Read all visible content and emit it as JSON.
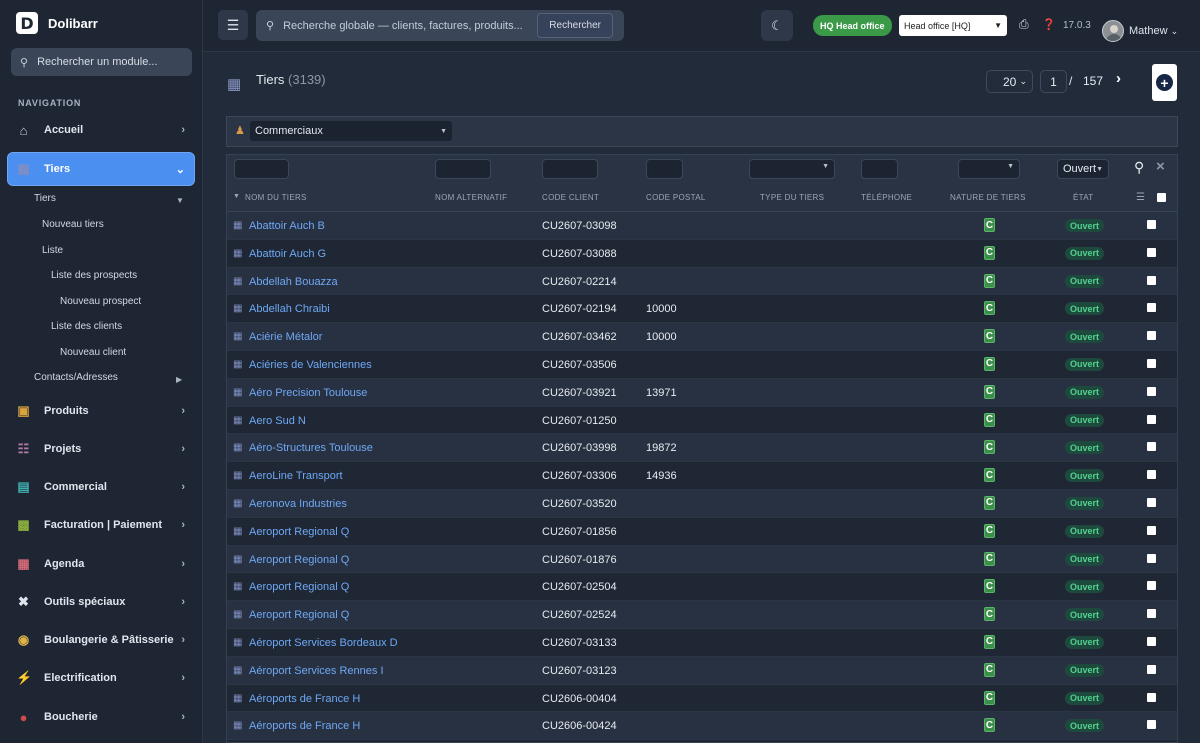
{
  "brand": {
    "logo": "D",
    "name": "Dolibarr"
  },
  "sidebar": {
    "module_search_placeholder": "Rechercher un module...",
    "heading": "NAVIGATION",
    "main_items": [
      {
        "label": "Accueil",
        "icon": "home-icon"
      },
      {
        "label": "Tiers",
        "icon": "building-icon",
        "active": true
      },
      {
        "label": "Produits",
        "icon": "box-icon"
      },
      {
        "label": "Projets",
        "icon": "sitemap-icon"
      },
      {
        "label": "Commercial",
        "icon": "briefcase-icon"
      },
      {
        "label": "Facturation | Paiement",
        "icon": "invoice-icon"
      },
      {
        "label": "Agenda",
        "icon": "calendar-icon"
      },
      {
        "label": "Outils spéciaux",
        "icon": "tools-icon"
      },
      {
        "label": "Boulangerie & Pâtisserie",
        "icon": "bread-icon"
      },
      {
        "label": "Electrification",
        "icon": "lightning-icon"
      },
      {
        "label": "Boucherie",
        "icon": "meat-icon"
      }
    ],
    "sub_items": [
      {
        "label": "Tiers"
      },
      {
        "label": "Nouveau tiers"
      },
      {
        "label": "Liste"
      },
      {
        "label": "Liste des prospects"
      },
      {
        "label": "Nouveau prospect"
      },
      {
        "label": "Liste des clients"
      },
      {
        "label": "Nouveau client"
      },
      {
        "label": "Contacts/Adresses"
      }
    ]
  },
  "topbar": {
    "search_placeholder": "Recherche globale — clients, factures, produits...",
    "search_button": "Rechercher",
    "entity_badge": "HQ  Head office",
    "entity_select": "Head office [HQ]",
    "version": "17.0.3",
    "user": "Mathew"
  },
  "page": {
    "title": "Tiers",
    "count": "(3139)",
    "page_limit": "20",
    "current_page": "1",
    "page_sep": "/",
    "total_pages": "157"
  },
  "filter": {
    "sales_rep": "Commerciaux"
  },
  "table": {
    "status_filter": "Ouvert",
    "columns": [
      "NOM DU TIERS",
      "NOM ALTERNATIF",
      "CODE CLIENT",
      "CODE POSTAL",
      "TYPE DU TIERS",
      "TÉLÉPHONE",
      "NATURE DE TIERS",
      "ÉTAT"
    ],
    "rows": [
      {
        "name": "Abattoir Auch B",
        "code": "CU2607-03098",
        "zip": "",
        "nature": "C",
        "status": "Ouvert"
      },
      {
        "name": "Abattoir Auch G",
        "code": "CU2607-03088",
        "zip": "",
        "nature": "C",
        "status": "Ouvert"
      },
      {
        "name": "Abdellah Bouazza",
        "code": "CU2607-02214",
        "zip": "",
        "nature": "C",
        "status": "Ouvert"
      },
      {
        "name": "Abdellah Chraibi",
        "code": "CU2607-02194",
        "zip": "10000",
        "nature": "C",
        "status": "Ouvert"
      },
      {
        "name": "Aciérie Métalor",
        "code": "CU2607-03462",
        "zip": "10000",
        "nature": "C",
        "status": "Ouvert"
      },
      {
        "name": "Aciéries de Valenciennes",
        "code": "CU2607-03506",
        "zip": "",
        "nature": "C",
        "status": "Ouvert"
      },
      {
        "name": "Aéro Precision Toulouse",
        "code": "CU2607-03921",
        "zip": "13971",
        "nature": "C",
        "status": "Ouvert"
      },
      {
        "name": "Aero Sud N",
        "code": "CU2607-01250",
        "zip": "",
        "nature": "C",
        "status": "Ouvert"
      },
      {
        "name": "Aéro-Structures Toulouse",
        "code": "CU2607-03998",
        "zip": "19872",
        "nature": "C",
        "status": "Ouvert"
      },
      {
        "name": "AeroLine Transport",
        "code": "CU2607-03306",
        "zip": "14936",
        "nature": "C",
        "status": "Ouvert"
      },
      {
        "name": "Aeronova Industries",
        "code": "CU2607-03520",
        "zip": "",
        "nature": "C",
        "status": "Ouvert"
      },
      {
        "name": "Aeroport Regional Q",
        "code": "CU2607-01856",
        "zip": "",
        "nature": "C",
        "status": "Ouvert"
      },
      {
        "name": "Aeroport Regional Q",
        "code": "CU2607-01876",
        "zip": "",
        "nature": "C",
        "status": "Ouvert"
      },
      {
        "name": "Aeroport Regional Q",
        "code": "CU2607-02504",
        "zip": "",
        "nature": "C",
        "status": "Ouvert"
      },
      {
        "name": "Aeroport Regional Q",
        "code": "CU2607-02524",
        "zip": "",
        "nature": "C",
        "status": "Ouvert"
      },
      {
        "name": "Aéroport Services Bordeaux D",
        "code": "CU2607-03133",
        "zip": "",
        "nature": "C",
        "status": "Ouvert"
      },
      {
        "name": "Aéroport Services Rennes I",
        "code": "CU2607-03123",
        "zip": "",
        "nature": "C",
        "status": "Ouvert"
      },
      {
        "name": "Aéroports de France H",
        "code": "CU2606-00404",
        "zip": "",
        "nature": "C",
        "status": "Ouvert"
      },
      {
        "name": "Aéroports de France H",
        "code": "CU2606-00424",
        "zip": "",
        "nature": "C",
        "status": "Ouvert"
      }
    ]
  },
  "colors": {
    "accent": "#4b8ff0",
    "link": "#6ea8f5",
    "status_open": "#52d18f",
    "entity_badge": "#3a9a48"
  }
}
